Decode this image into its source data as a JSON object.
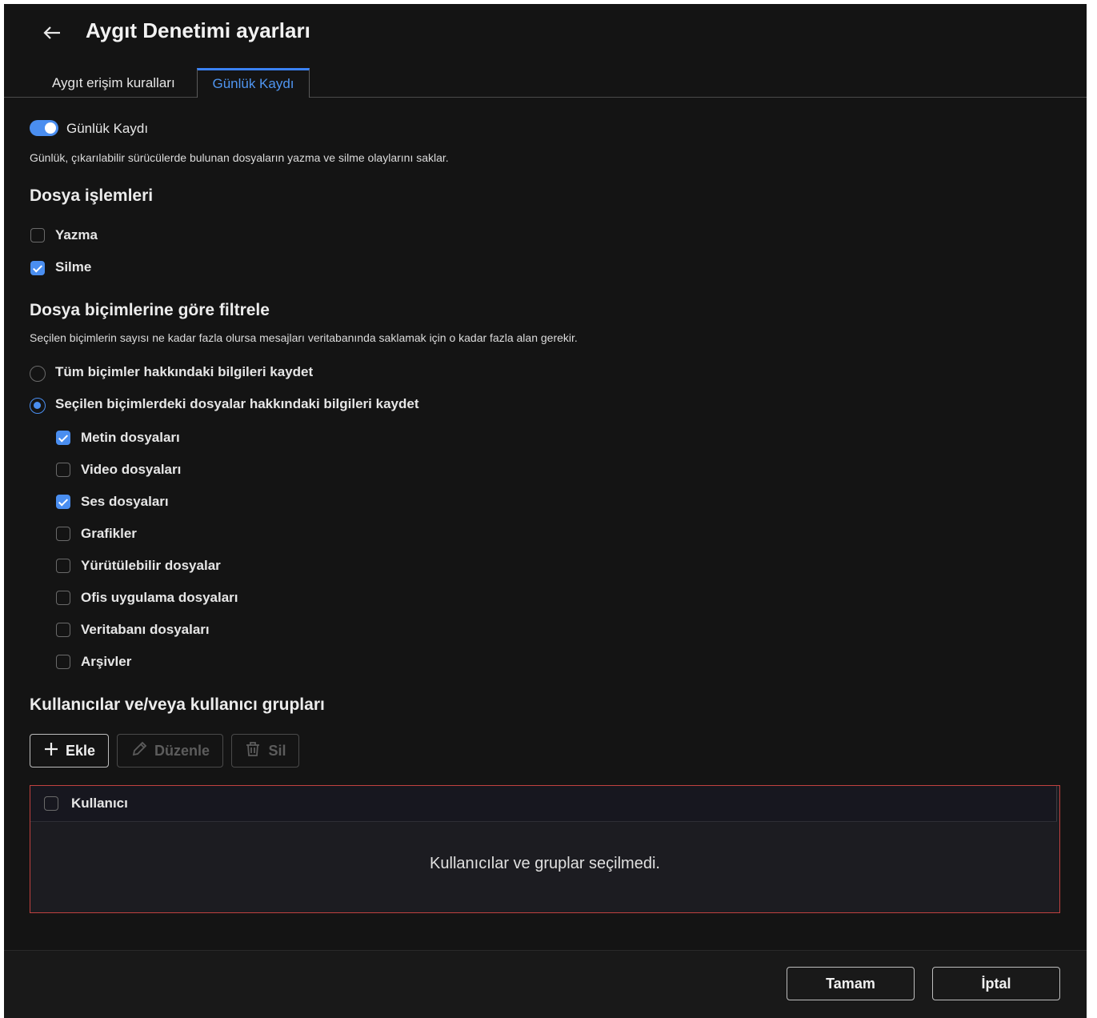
{
  "header": {
    "title": "Aygıt Denetimi ayarları",
    "back_icon": "arrow-left-icon"
  },
  "tabs": [
    {
      "label": "Aygıt erişim kuralları",
      "active": false
    },
    {
      "label": "Günlük Kaydı",
      "active": true
    }
  ],
  "logging": {
    "toggle_label": "Günlük Kaydı",
    "toggle_on": true,
    "description": "Günlük, çıkarılabilir sürücülerde bulunan dosyaların yazma ve silme olaylarını saklar."
  },
  "file_ops": {
    "heading": "Dosya işlemleri",
    "items": [
      {
        "label": "Yazma",
        "checked": false
      },
      {
        "label": "Silme",
        "checked": true
      }
    ]
  },
  "format_filter": {
    "heading": "Dosya biçimlerine göre filtrele",
    "description": "Seçilen biçimlerin sayısı ne kadar fazla olursa mesajları veritabanında saklamak için o kadar fazla alan gerekir.",
    "radios": [
      {
        "label": "Tüm biçimler hakkındaki bilgileri kaydet",
        "selected": false
      },
      {
        "label": "Seçilen biçimlerdeki dosyalar hakkındaki bilgileri kaydet",
        "selected": true
      }
    ],
    "formats": [
      {
        "label": "Metin dosyaları",
        "checked": true
      },
      {
        "label": "Video dosyaları",
        "checked": false
      },
      {
        "label": "Ses dosyaları",
        "checked": true
      },
      {
        "label": "Grafikler",
        "checked": false
      },
      {
        "label": "Yürütülebilir dosyalar",
        "checked": false
      },
      {
        "label": "Ofis uygulama dosyaları",
        "checked": false
      },
      {
        "label": "Veritabanı dosyaları",
        "checked": false
      },
      {
        "label": "Arşivler",
        "checked": false
      }
    ]
  },
  "users": {
    "heading": "Kullanıcılar ve/veya kullanıcı grupları",
    "buttons": {
      "add": {
        "label": "Ekle",
        "icon": "plus-icon",
        "enabled": true
      },
      "edit": {
        "label": "Düzenle",
        "icon": "pencil-icon",
        "enabled": false
      },
      "delete": {
        "label": "Sil",
        "icon": "trash-icon",
        "enabled": false
      }
    },
    "table": {
      "column_header": "Kullanıcı",
      "empty_message": "Kullanıcılar ve gruplar seçilmedi."
    }
  },
  "footer": {
    "ok_label": "Tamam",
    "cancel_label": "İptal"
  },
  "colors": {
    "accent": "#4a8ef0",
    "background": "#141414",
    "error_border": "#c0413f"
  }
}
